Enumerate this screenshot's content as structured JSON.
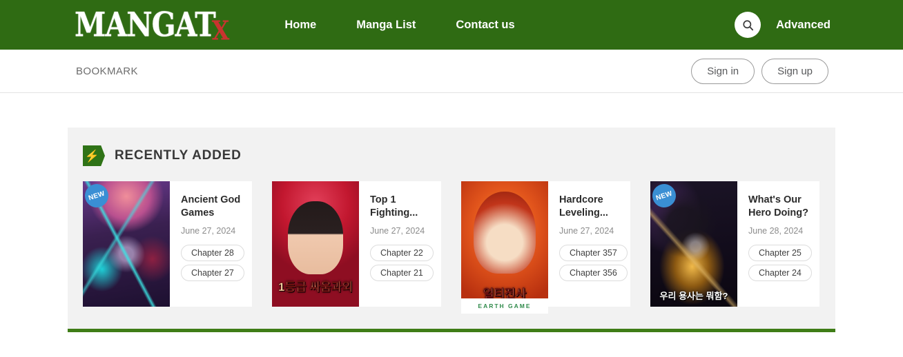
{
  "site": {
    "logo_main": "MANGAT",
    "logo_accent": "X",
    "brand_green": "#2f6b13",
    "accent_red": "#c9332f"
  },
  "topnav": {
    "links": [
      {
        "label": "Home"
      },
      {
        "label": "Manga List"
      },
      {
        "label": "Contact us"
      }
    ],
    "search_icon": "search-icon",
    "advanced_label": "Advanced"
  },
  "bookmarkbar": {
    "label": "BOOKMARK",
    "signin_label": "Sign in",
    "signup_label": "Sign up"
  },
  "recently_added": {
    "icon": "bolt-icon",
    "title": "RECENTLY ADDED",
    "cards": [
      {
        "title": "Ancient God Games",
        "date": "June 27, 2024",
        "badge": "NEW",
        "has_badge": true,
        "cover_text": "",
        "chapters": [
          "Chapter 28",
          "Chapter 27"
        ]
      },
      {
        "title": "Top 1 Fighting...",
        "date": "June 27, 2024",
        "badge": "",
        "has_badge": false,
        "cover_text": "1등급 싸움과외",
        "chapters": [
          "Chapter 22",
          "Chapter 21"
        ]
      },
      {
        "title": "Hardcore Leveling...",
        "date": "June 27, 2024",
        "badge": "",
        "has_badge": false,
        "cover_text": "얼티전사",
        "cover_footer": "EARTH GAME",
        "chapters": [
          "Chapter 357",
          "Chapter 356"
        ]
      },
      {
        "title": "What's Our Hero Doing?",
        "date": "June 28, 2024",
        "badge": "NEW",
        "has_badge": true,
        "cover_text": "우리 용사는 뭐함?",
        "chapters": [
          "Chapter 25",
          "Chapter 24"
        ]
      }
    ]
  }
}
